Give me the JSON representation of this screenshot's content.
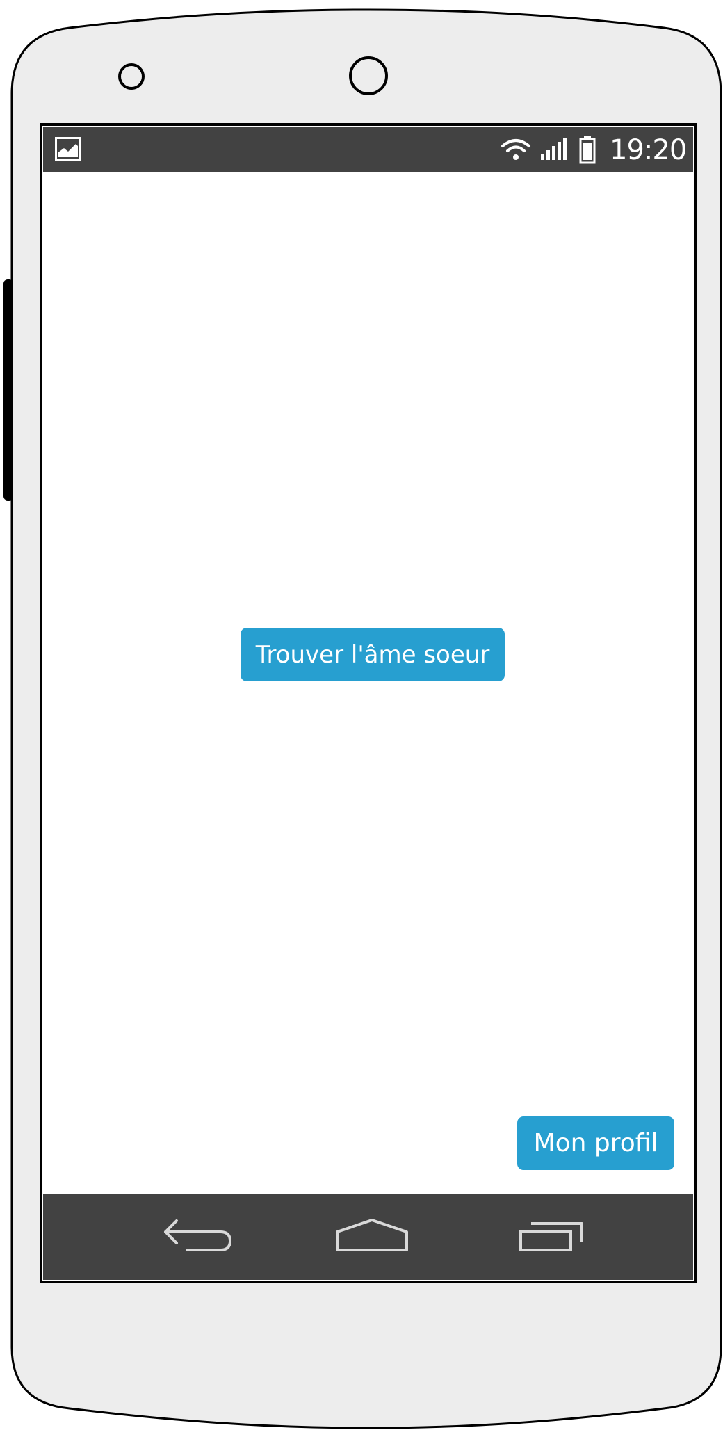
{
  "status_bar": {
    "time": "19:20",
    "icons": [
      "gallery-icon",
      "wifi-icon",
      "signal-icon",
      "battery-icon"
    ]
  },
  "main": {
    "primary_button_label": "Trouver l'âme soeur",
    "profile_button_label": "Mon profil"
  },
  "nav_bar": {
    "icons": [
      "back-icon",
      "home-icon",
      "recents-icon"
    ]
  },
  "colors": {
    "accent": "#279fd0",
    "bar": "#424242",
    "device_body": "#ededed"
  }
}
